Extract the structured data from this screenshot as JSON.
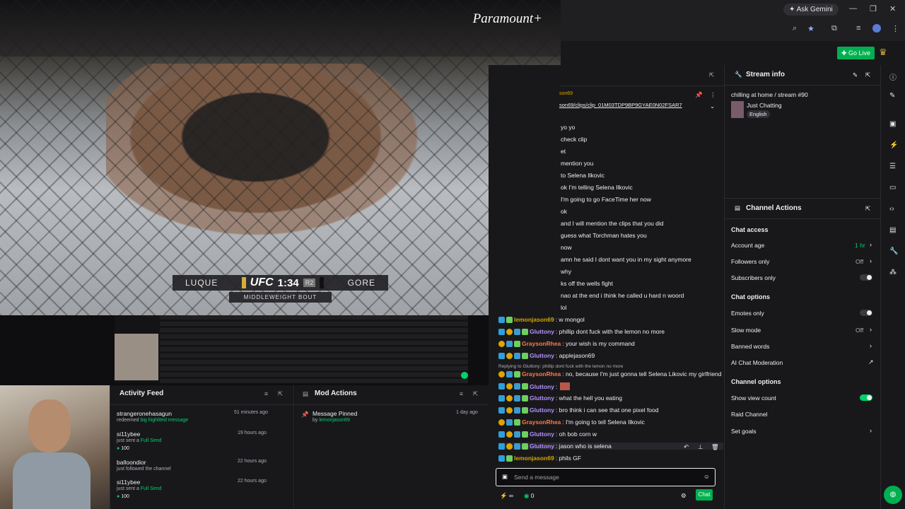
{
  "video": {
    "brand": "Paramount+",
    "fighter_left": "LUQUE",
    "league": "UFC",
    "clock": "1:34",
    "round": "R2",
    "fighter_right": "GORE",
    "bout": "MIDDLEWEIGHT BOUT"
  },
  "browser": {
    "gemini": "Ask Gemini"
  },
  "topbar": {
    "go_live": "Go Live"
  },
  "chat": {
    "clip_user": "son69",
    "clip_link": "son69/clips/clip_01M03TDP9BP9GYAE0N02FSAR7",
    "lines": [
      "yo yo",
      "check clip",
      "et",
      "mention you",
      "to Selena Ilkovic",
      "ok I'm telling Selena Ilkovic",
      "I'm going to go FaceTime her now",
      "ok",
      "and I will mention the clips that you did",
      "guess what Torchman hates you",
      "now",
      "amn he said I dont want you in my sight anymore",
      "why",
      "ks off the wells fight",
      "nao at the end i think he called u hard n woord",
      "lol"
    ],
    "messages": [
      {
        "user": "lemonjason69",
        "cls": "l",
        "text": ": w mongol"
      },
      {
        "user": "Gluttony",
        "cls": "g",
        "text": ": phillip dont fuck with the lemon no more"
      },
      {
        "user": "GraysonRhea",
        "cls": "r",
        "text": ": your wish is my command"
      },
      {
        "user": "Gluttony",
        "cls": "g",
        "text": ": applejason69"
      },
      {
        "user": "GraysonRhea",
        "cls": "r",
        "text": ": no, because I'm just gonna tell Selena Likovic my girlfriend"
      },
      {
        "user": "Gluttony",
        "cls": "g",
        "text": ":"
      },
      {
        "user": "Gluttony",
        "cls": "g",
        "text": ": what the hell you eating"
      },
      {
        "user": "Gluttony",
        "cls": "g",
        "text": ": bro think i can see that one pixel food"
      },
      {
        "user": "GraysonRhea",
        "cls": "r",
        "text": ": I'm going to tell Selena Ilkovic"
      },
      {
        "user": "Gluttony",
        "cls": "g",
        "text": ": oh bob corn w"
      },
      {
        "user": "Gluttony",
        "cls": "g",
        "text": ": jason who is selena"
      },
      {
        "user": "lemonjason69",
        "cls": "l",
        "text": ": phils GF"
      }
    ],
    "reply_note": "Replying to Gluttony: phillip dont fuck with the lemon no more",
    "placeholder": "Send a message",
    "points": "0",
    "chat_button": "Chat"
  },
  "stream_info": {
    "title": "Stream info",
    "stream_title": "chilling at home / stream #90",
    "category": "Just Chatting",
    "language": "English"
  },
  "channel_actions": {
    "title": "Channel Actions",
    "chat_access": "Chat access",
    "account_age": "Account age",
    "account_age_value": "1 hr",
    "followers_only": "Followers only",
    "followers_only_value": "Off",
    "subscribers_only": "Subscribers only",
    "chat_options": "Chat options",
    "emotes_only": "Emotes only",
    "slow_mode": "Slow mode",
    "slow_mode_value": "Off",
    "banned_words": "Banned words",
    "ai_mod": "AI Chat Moderation",
    "channel_options": "Channel options",
    "show_view_count": "Show view count",
    "raid_channel": "Raid Channel",
    "set_goals": "Set goals"
  },
  "activity_feed": {
    "title": "Activity Feed",
    "items": [
      {
        "user": "strangeronehasagun",
        "time": "51 minutes ago",
        "action": "redeemed",
        "detail": "big highlited message"
      },
      {
        "user": "si11ybee",
        "time": "19 hours ago",
        "action": "just sent a",
        "detail": "Full Send",
        "amount": "100"
      },
      {
        "user": "balloondior",
        "time": "22 hours ago",
        "action": "just followed the channel"
      },
      {
        "user": "si11ybee",
        "time": "22 hours ago",
        "action": "just sent a",
        "detail": "Full Send",
        "amount": "100"
      }
    ]
  },
  "mod_actions": {
    "title": "Mod Actions",
    "item_title": "Message Pinned",
    "item_by": "by",
    "item_user": "lemonjason69",
    "item_time": "1 day ago"
  }
}
